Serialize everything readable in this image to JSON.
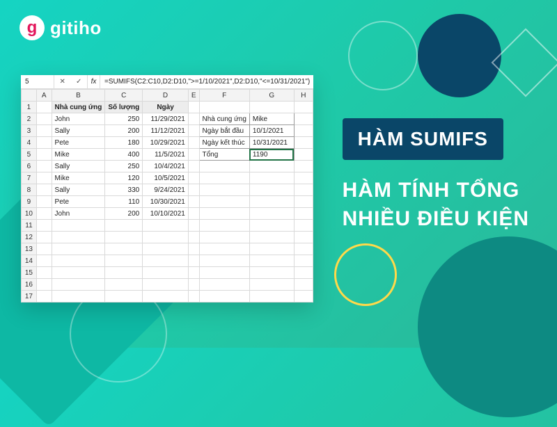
{
  "brand": {
    "initial": "g",
    "name": "gitiho"
  },
  "hero": {
    "title": "HÀM SUMIFS",
    "subtitle_line1": "HÀM TÍNH TỔNG",
    "subtitle_line2": "NHIỀU ĐIỀU KIỆN"
  },
  "spreadsheet": {
    "name_box": "5",
    "fx_check": "✓",
    "fx_x": "✕",
    "fx_label": "fx",
    "formula": "=SUMIFS(C2:C10,D2:D10,\">=1/10/2021\",D2:D10,\"<=10/31/2021\")",
    "col_headers": [
      "A",
      "B",
      "C",
      "D",
      "E",
      "F",
      "G",
      "H"
    ],
    "row_headers": [
      "1",
      "2",
      "3",
      "4",
      "5",
      "6",
      "7",
      "8",
      "9",
      "10",
      "11",
      "12",
      "13",
      "14",
      "15",
      "16",
      "17"
    ],
    "data_headers": {
      "B": "Nhà cung ứng",
      "C": "Số lượng",
      "D": "Ngày"
    },
    "rows": [
      {
        "B": "John",
        "C": "250",
        "D": "11/29/2021"
      },
      {
        "B": "Sally",
        "C": "200",
        "D": "11/12/2021"
      },
      {
        "B": "Pete",
        "C": "180",
        "D": "10/29/2021"
      },
      {
        "B": "Mike",
        "C": "400",
        "D": "11/5/2021"
      },
      {
        "B": "Sally",
        "C": "250",
        "D": "10/4/2021"
      },
      {
        "B": "Mike",
        "C": "120",
        "D": "10/5/2021"
      },
      {
        "B": "Sally",
        "C": "330",
        "D": "9/24/2021"
      },
      {
        "B": "Pete",
        "C": "110",
        "D": "10/30/2021"
      },
      {
        "B": "John",
        "C": "200",
        "D": "10/10/2021"
      }
    ],
    "side_box": {
      "r2": {
        "F": "Nhà cung ứng",
        "G": "Mike"
      },
      "r3": {
        "F": "Ngày bắt đầu",
        "G": "10/1/2021"
      },
      "r4": {
        "F": "Ngày kết thúc",
        "G": "10/31/2021"
      },
      "r5": {
        "F": "Tổng",
        "G": "1190"
      }
    }
  }
}
